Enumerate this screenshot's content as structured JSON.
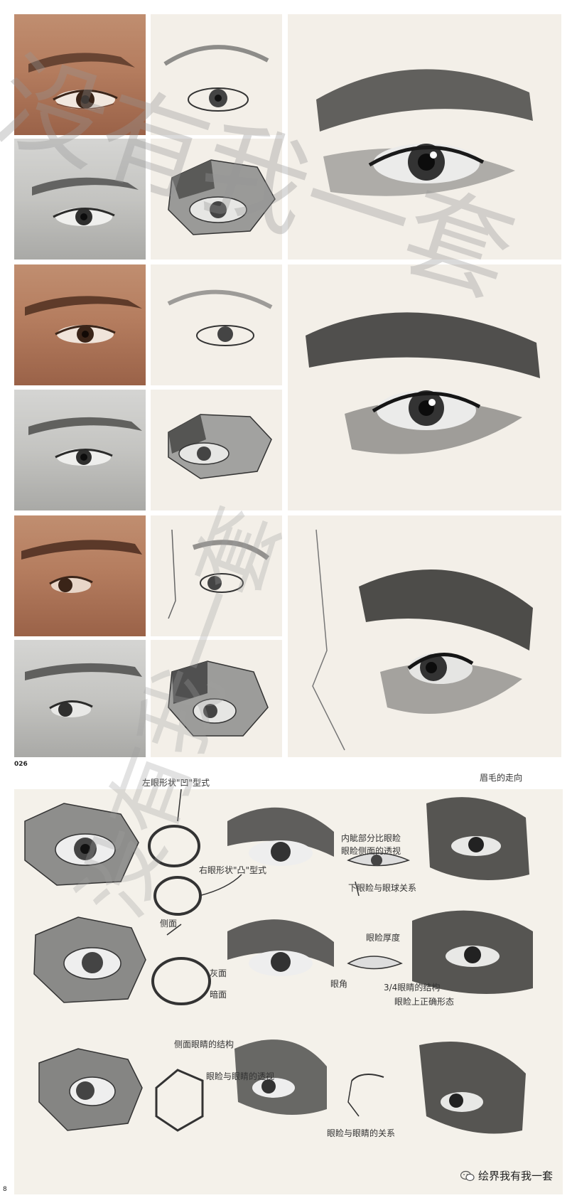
{
  "page_number": "026",
  "side_mark": "8",
  "watermark": {
    "text_top": "没有我一套",
    "text_bottom": "没有我一套"
  },
  "sheet_annotations": [
    "左眼形状\"凹\"型式",
    "右眼形状\"凸\"型式",
    "侧面",
    "暗面",
    "灰面",
    "眉毛的走向",
    "内眦部分比眼睑",
    "眼睑侧面的透视",
    "下眼睑与眼球关系",
    "眼睑厚度",
    "眼角",
    "3/4眼睛的结构",
    "眼睑上正确形态",
    "侧面眼睛的结构",
    "眼睑与眼睛的关系",
    "眼睑与眼睛的透视"
  ],
  "brand": {
    "label": "绘界我有我一套",
    "icon": "wechat-icon"
  }
}
